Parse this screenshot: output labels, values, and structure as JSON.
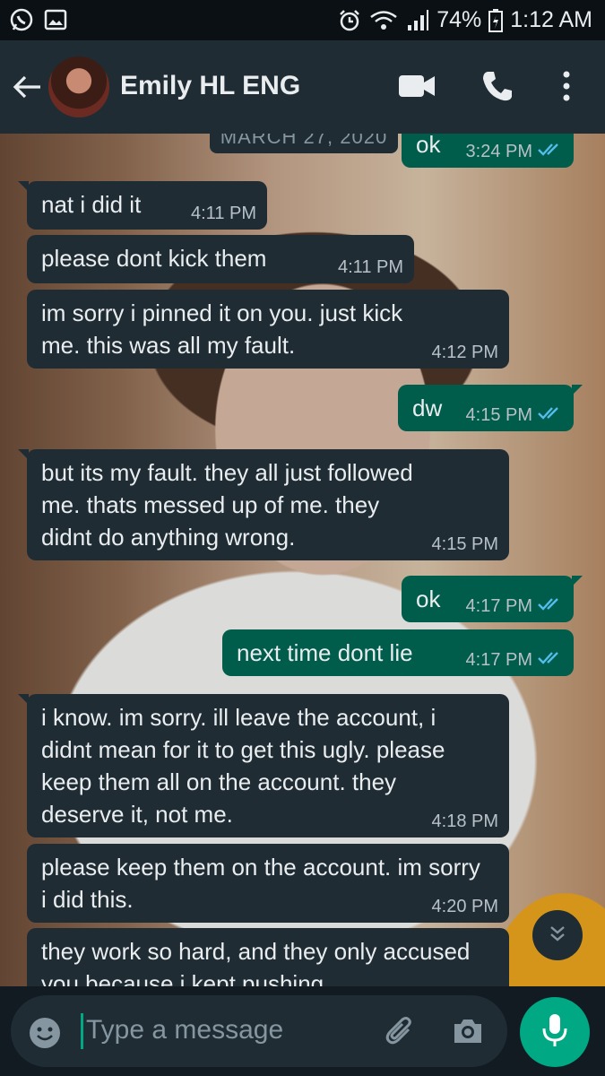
{
  "status_bar": {
    "battery": "74%",
    "time": "1:12 AM",
    "icons": [
      "whatsapp-icon",
      "gallery-icon",
      "alarm-icon",
      "wifi-icon",
      "signal-icon",
      "battery-icon"
    ]
  },
  "header": {
    "contact_name": "Emily HL ENG",
    "icons": [
      "back-arrow-icon",
      "avatar",
      "video-call-icon",
      "voice-call-icon",
      "more-options-icon"
    ]
  },
  "chat": {
    "date_label": "MARCH 27, 2020",
    "messages": [
      {
        "side": "out",
        "text": "ok",
        "time": "3:24 PM",
        "ticks": "read"
      },
      {
        "side": "in",
        "text": "nat i did it",
        "time": "4:11 PM"
      },
      {
        "side": "in",
        "text": "please dont kick them",
        "time": "4:11 PM"
      },
      {
        "side": "in",
        "text": "im sorry i pinned it on you. just kick me. this was all my fault.",
        "time": "4:12 PM"
      },
      {
        "side": "out",
        "text": "dw",
        "time": "4:15 PM",
        "ticks": "read"
      },
      {
        "side": "in",
        "text": "but its my fault. they all just followed me. thats messed up of me. they didnt do anything wrong.",
        "time": "4:15 PM"
      },
      {
        "side": "out",
        "text": "ok",
        "time": "4:17 PM",
        "ticks": "read"
      },
      {
        "side": "out",
        "text": "next time dont lie",
        "time": "4:17 PM",
        "ticks": "read"
      },
      {
        "side": "in",
        "text": "i know. im sorry. ill leave the account, i didnt mean for it to get this ugly. please keep them all on the account. they deserve it, not me.",
        "time": "4:18 PM"
      },
      {
        "side": "in",
        "text": "please keep them on the account. im sorry i did this.",
        "time": "4:20 PM"
      },
      {
        "side": "in",
        "text": "they work so hard, and they only accused you because i kept pushing",
        "time": ""
      }
    ]
  },
  "composer": {
    "placeholder": "Type a message",
    "icons": [
      "emoji-icon",
      "attach-icon",
      "camera-icon",
      "mic-icon"
    ]
  },
  "colors": {
    "incoming_bubble": "#1f2c34",
    "outgoing_bubble": "#005c4b",
    "accent": "#00a884",
    "read_tick": "#53bdeb"
  }
}
